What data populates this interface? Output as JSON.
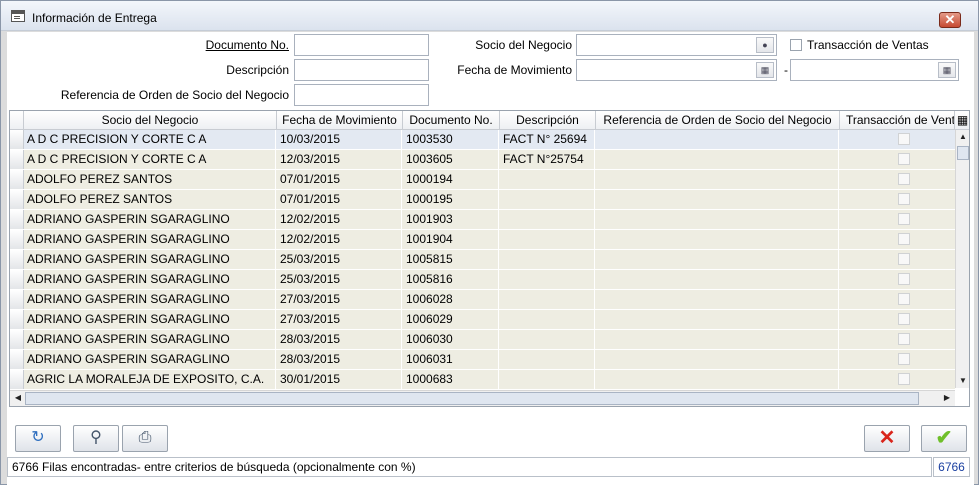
{
  "window": {
    "title": "Información de Entrega",
    "close_icon": "close-x-icon"
  },
  "search": {
    "documento_label": "Documento No.",
    "descripcion_label": "Descripción",
    "referencia_label": "Referencia de Orden de Socio del Negocio",
    "socio_label": "Socio del Negocio",
    "fecha_label": "Fecha de Movimiento",
    "fecha_separator": "-",
    "transaccion_label": "Transacción de Ventas",
    "documento_value": "",
    "descripcion_value": "",
    "referencia_value": "",
    "socio_value": "",
    "fecha_desde_value": "",
    "fecha_hasta_value": ""
  },
  "grid": {
    "columns": [
      "Socio del Negocio",
      "Fecha de Movimiento",
      "Documento No.",
      "Descripción",
      "Referencia de Orden de Socio del Negocio",
      "Transacción de Ventas"
    ],
    "rows": [
      {
        "socio": "A D C  PRECISION Y CORTE  C A",
        "fecha": "10/03/2015",
        "documento": "1003530",
        "descripcion": "FACT N° 25694",
        "referencia": ""
      },
      {
        "socio": "A D C  PRECISION Y CORTE  C A",
        "fecha": "12/03/2015",
        "documento": "1003605",
        "descripcion": "FACT N°25754",
        "referencia": ""
      },
      {
        "socio": "ADOLFO PEREZ SANTOS",
        "fecha": "07/01/2015",
        "documento": "1000194",
        "descripcion": "",
        "referencia": ""
      },
      {
        "socio": "ADOLFO PEREZ SANTOS",
        "fecha": "07/01/2015",
        "documento": "1000195",
        "descripcion": "",
        "referencia": ""
      },
      {
        "socio": "ADRIANO GASPERIN SGARAGLINO",
        "fecha": "12/02/2015",
        "documento": "1001903",
        "descripcion": "",
        "referencia": ""
      },
      {
        "socio": "ADRIANO GASPERIN SGARAGLINO",
        "fecha": "12/02/2015",
        "documento": "1001904",
        "descripcion": "",
        "referencia": ""
      },
      {
        "socio": "ADRIANO GASPERIN SGARAGLINO",
        "fecha": "25/03/2015",
        "documento": "1005815",
        "descripcion": "",
        "referencia": ""
      },
      {
        "socio": "ADRIANO GASPERIN SGARAGLINO",
        "fecha": "25/03/2015",
        "documento": "1005816",
        "descripcion": "",
        "referencia": ""
      },
      {
        "socio": "ADRIANO GASPERIN SGARAGLINO",
        "fecha": "27/03/2015",
        "documento": "1006028",
        "descripcion": "",
        "referencia": ""
      },
      {
        "socio": "ADRIANO GASPERIN SGARAGLINO",
        "fecha": "27/03/2015",
        "documento": "1006029",
        "descripcion": "",
        "referencia": ""
      },
      {
        "socio": "ADRIANO GASPERIN SGARAGLINO",
        "fecha": "28/03/2015",
        "documento": "1006030",
        "descripcion": "",
        "referencia": ""
      },
      {
        "socio": "ADRIANO GASPERIN SGARAGLINO",
        "fecha": "28/03/2015",
        "documento": "1006031",
        "descripcion": "",
        "referencia": ""
      },
      {
        "socio": "AGRIC  LA MORALEJA DE EXPOSITO,  C.A.",
        "fecha": "30/01/2015",
        "documento": "1000683",
        "descripcion": "",
        "referencia": ""
      }
    ]
  },
  "toolbar": {
    "refresh_icon": "refresh-icon",
    "zoom_icon": "zoom-icon",
    "print_icon": "print-icon",
    "cancel_icon": "cancel-icon",
    "ok_icon": "ok-check-icon"
  },
  "status": {
    "message": "6766 Filas encontradas- entre criterios de búsqueda (opcionalmente con %)",
    "count": "6766"
  },
  "colors": {
    "row_bg": "#eeede2",
    "selected_row": "#e3e9f2",
    "cancel_red": "#d9261c",
    "ok_green": "#6fbf2a"
  }
}
